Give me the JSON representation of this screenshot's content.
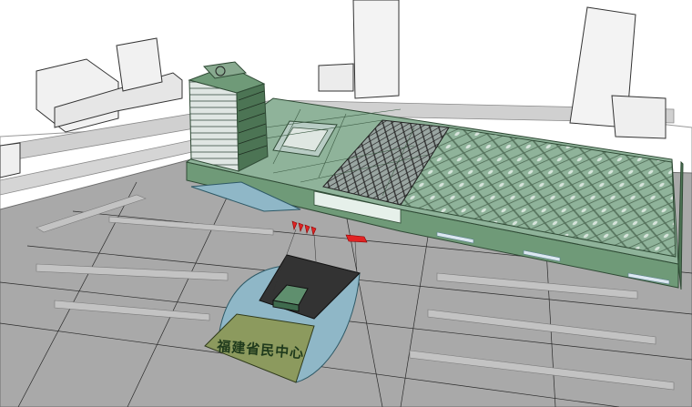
{
  "scene": {
    "sign": {
      "text": "福建省民中心"
    },
    "colors": {
      "background": "#ffffff",
      "ground": "#a9a9a9",
      "road": "#c9c9c9",
      "building_green": "#6f9a78",
      "building_green_dark": "#4c7454",
      "roof_green": "#8fb39a",
      "glass": "#b8ccc4",
      "water": "#8fb7c7",
      "lawn": "#8c9a5e",
      "plaza_dark": "#333333",
      "white_block": "#f4f4f4",
      "red_accent": "#e02424",
      "line": "#222222"
    }
  }
}
